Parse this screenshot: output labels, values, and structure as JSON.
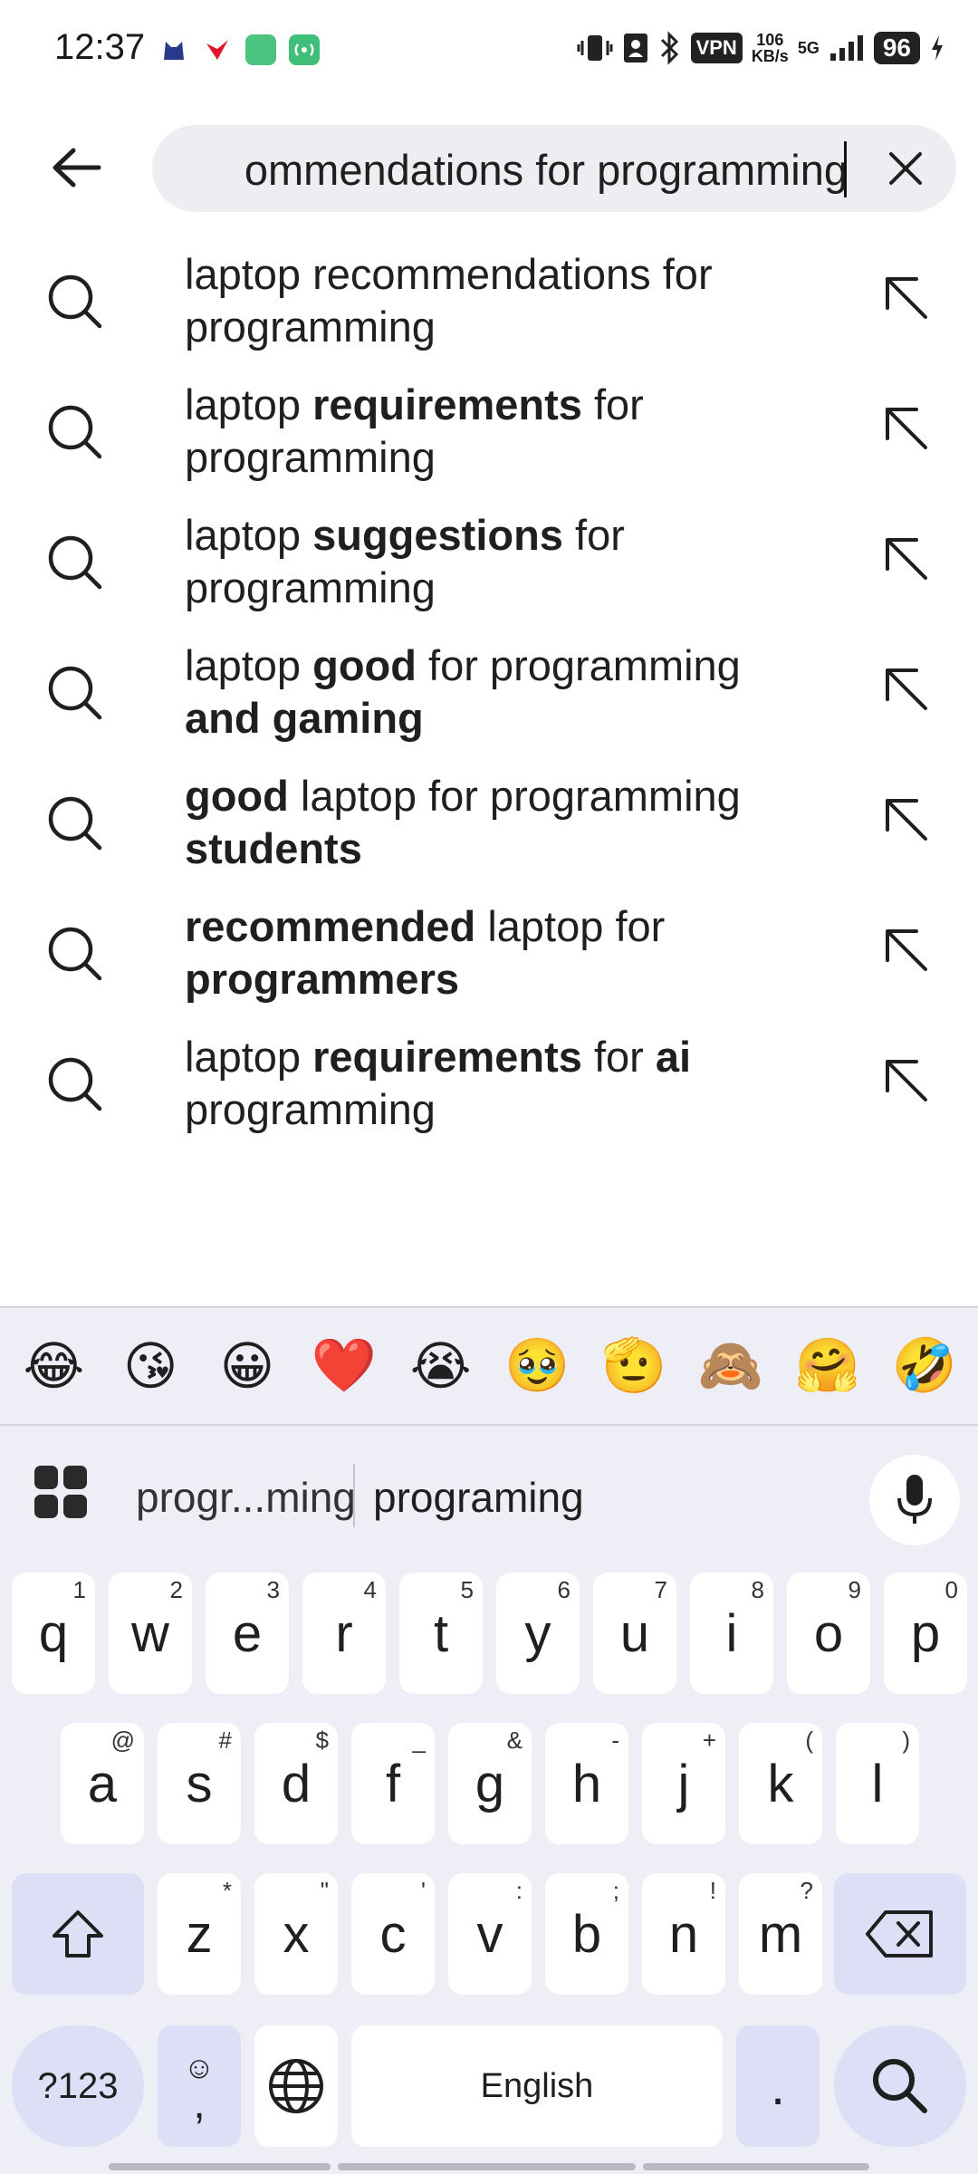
{
  "status_bar": {
    "time": "12:37",
    "vpn": "VPN",
    "speed_value": "106",
    "speed_unit": "KB/s",
    "network": "5G",
    "battery": "96"
  },
  "search": {
    "query_visible": "ommendations for programming",
    "query_full": "laptop recommendations for programming"
  },
  "suggestions": [
    {
      "parts": [
        {
          "t": "laptop recommendations for programming",
          "b": false
        }
      ]
    },
    {
      "parts": [
        {
          "t": "laptop ",
          "b": false
        },
        {
          "t": "requirements",
          "b": true
        },
        {
          "t": " for programming",
          "b": false
        }
      ]
    },
    {
      "parts": [
        {
          "t": "laptop ",
          "b": false
        },
        {
          "t": "suggestions",
          "b": true
        },
        {
          "t": " for programming",
          "b": false
        }
      ]
    },
    {
      "parts": [
        {
          "t": "laptop ",
          "b": false
        },
        {
          "t": "good",
          "b": true
        },
        {
          "t": " for programming ",
          "b": false
        },
        {
          "t": "and gaming",
          "b": true
        }
      ]
    },
    {
      "parts": [
        {
          "t": "good",
          "b": true
        },
        {
          "t": " laptop for programming ",
          "b": false
        },
        {
          "t": "students",
          "b": true
        }
      ]
    },
    {
      "parts": [
        {
          "t": "recommended",
          "b": true
        },
        {
          "t": " laptop for ",
          "b": false
        },
        {
          "t": "programmers",
          "b": true
        }
      ]
    },
    {
      "parts": [
        {
          "t": "laptop ",
          "b": false
        },
        {
          "t": "requirements",
          "b": true
        },
        {
          "t": " for ",
          "b": false
        },
        {
          "t": "ai",
          "b": true
        },
        {
          "t": " programming",
          "b": false
        }
      ]
    }
  ],
  "keyboard": {
    "emojis": [
      "😂",
      "😘",
      "😀",
      "❤️",
      "😭",
      "🥹",
      "🫡",
      "🙈",
      "🤗",
      "🤣"
    ],
    "suggestion_1": "progr...ming",
    "suggestion_2": "programing",
    "row1": [
      {
        "k": "q",
        "h": "1"
      },
      {
        "k": "w",
        "h": "2"
      },
      {
        "k": "e",
        "h": "3"
      },
      {
        "k": "r",
        "h": "4"
      },
      {
        "k": "t",
        "h": "5"
      },
      {
        "k": "y",
        "h": "6"
      },
      {
        "k": "u",
        "h": "7"
      },
      {
        "k": "i",
        "h": "8"
      },
      {
        "k": "o",
        "h": "9"
      },
      {
        "k": "p",
        "h": "0"
      }
    ],
    "row2": [
      {
        "k": "a",
        "h": "@"
      },
      {
        "k": "s",
        "h": "#"
      },
      {
        "k": "d",
        "h": "$"
      },
      {
        "k": "f",
        "h": "_"
      },
      {
        "k": "g",
        "h": "&"
      },
      {
        "k": "h",
        "h": "-"
      },
      {
        "k": "j",
        "h": "+"
      },
      {
        "k": "k",
        "h": "("
      },
      {
        "k": "l",
        "h": ")"
      }
    ],
    "row3": [
      {
        "k": "z",
        "h": "*"
      },
      {
        "k": "x",
        "h": "\""
      },
      {
        "k": "c",
        "h": "'"
      },
      {
        "k": "v",
        "h": ":"
      },
      {
        "k": "b",
        "h": ";"
      },
      {
        "k": "n",
        "h": "!"
      },
      {
        "k": "m",
        "h": "?"
      }
    ],
    "symbols_label": "?123",
    "emoji_key_top": "☺",
    "emoji_key_bottom": ",",
    "space_label": "English",
    "period_label": "."
  },
  "colors": {
    "accent_key": "#dcdff6",
    "keyboard_bg": "#eeeef6",
    "search_bg": "#eeeef2"
  }
}
